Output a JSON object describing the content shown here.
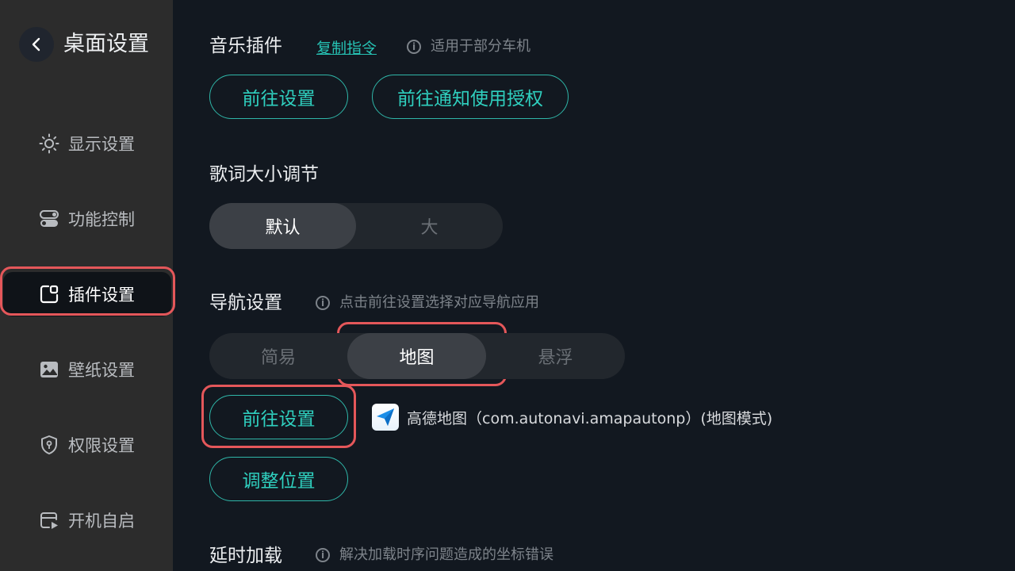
{
  "sidebar": {
    "title": "桌面设置",
    "items": [
      {
        "label": "显示设置",
        "icon": "sun-icon"
      },
      {
        "label": "功能控制",
        "icon": "toggle-icon"
      },
      {
        "label": "插件设置",
        "icon": "plugin-icon",
        "active": true
      },
      {
        "label": "壁纸设置",
        "icon": "image-icon"
      },
      {
        "label": "权限设置",
        "icon": "shield-icon"
      },
      {
        "label": "开机自启",
        "icon": "autostart-icon"
      }
    ]
  },
  "music": {
    "title": "音乐插件",
    "copy_link": "复制指令",
    "hint": "适用于部分车机",
    "goto_settings": "前往设置",
    "goto_notify": "前往通知使用授权"
  },
  "lyrics": {
    "title": "歌词大小调节",
    "options": [
      "默认",
      "大"
    ],
    "selected": "默认"
  },
  "nav": {
    "title": "导航设置",
    "hint": "点击前往设置选择对应导航应用",
    "options": [
      "简易",
      "地图",
      "悬浮"
    ],
    "selected": "地图",
    "goto_settings": "前往设置",
    "app_text": "高德地图（com.autonavi.amapautonp）(地图模式)",
    "adjust_position": "调整位置"
  },
  "delay": {
    "title": "延时加载",
    "hint": "解决加载时序问题造成的坐标错误"
  },
  "colors": {
    "accent": "#2fb6a8",
    "highlight": "#e4575a",
    "background": "#121820",
    "sidebar": "#2c2c2c"
  }
}
